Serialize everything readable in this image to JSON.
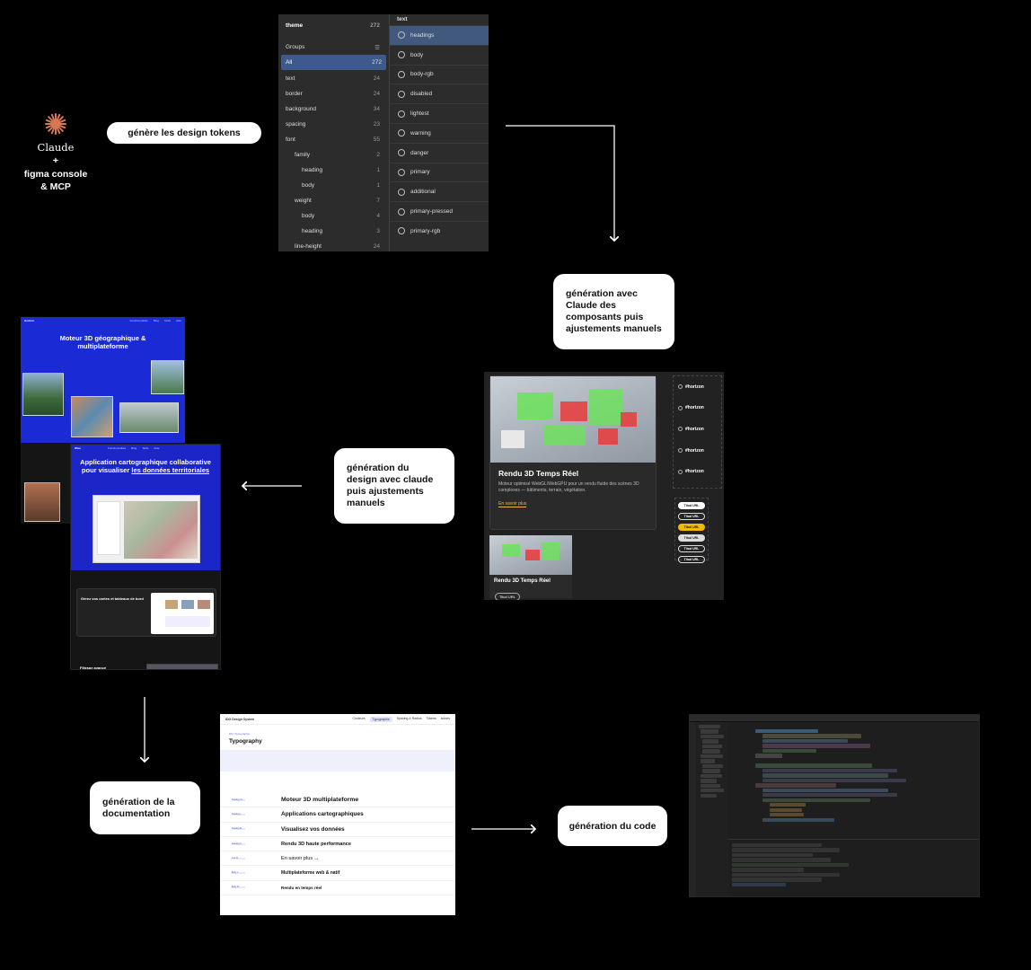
{
  "logo": {
    "wordmark": "Claude",
    "plus": "+",
    "line1": "figma console",
    "line2": "& MCP",
    "accent_color": "#d97757"
  },
  "steps": {
    "design_tokens": "génère les design tokens",
    "components": "génération avec Claude des composants puis ajustements manuels",
    "design": "génération du design avec claude puis ajustements manuels",
    "documentation": "génération de la documentation",
    "code": "génération du code"
  },
  "variables_panel": {
    "collection": "theme",
    "collection_count": "272",
    "groups_label": "Groups",
    "groups": [
      {
        "label": "All",
        "count": "272"
      },
      {
        "label": "text",
        "count": "24"
      },
      {
        "label": "border",
        "count": "24"
      },
      {
        "label": "background",
        "count": "34"
      },
      {
        "label": "spacing",
        "count": "23"
      },
      {
        "label": "font",
        "count": "55"
      },
      {
        "label": "family",
        "count": "2"
      },
      {
        "label": "heading",
        "count": "1"
      },
      {
        "label": "body",
        "count": "1"
      },
      {
        "label": "weight",
        "count": "7"
      },
      {
        "label": "body",
        "count": "4"
      },
      {
        "label": "heading",
        "count": "3"
      },
      {
        "label": "line-height",
        "count": "24"
      }
    ],
    "section_title": "text",
    "tokens": [
      "headings",
      "body",
      "body-rgb",
      "disabled",
      "lightest",
      "warning",
      "danger",
      "primary",
      "additional",
      "primary-pressed",
      "primary-rgb"
    ]
  },
  "components": {
    "card_title": "Rendu 3D Temps Réel",
    "card_desc": "Moteur optimisé WebGL/WebGPU pour un rendu fluide des scènes 3D complexes — bâtiments, terrain, végétation.",
    "card_link": "En savoir plus",
    "small_card_title": "Rendu 3D Temps Réel",
    "small_card_tag": "Titud URL",
    "variants": [
      "#horizon",
      "#horizon",
      "#horizon",
      "#horizon",
      "#horizon"
    ],
    "buttons": [
      "Titud URL",
      "Titud URL",
      "Titud URL",
      "Titud URL",
      "Titud URL",
      "Titud URL"
    ]
  },
  "site_a": {
    "title": "Moteur 3D géographique & multiplateforme",
    "brand": "Horizon",
    "nav": [
      "Fonctionnalités",
      "Blog",
      "Tarifs",
      "Aide"
    ]
  },
  "site_b": {
    "title_prefix": "Application cartographique collaborative pour visualiser",
    "title_highlight": "les données territoriales",
    "section_title": "Gérez vos cartes et tableaux de bord",
    "footer_title": "Filtrage avancé",
    "brand": "Wise",
    "nav": [
      "Fonctionnalités",
      "Blog",
      "Tarifs",
      "Aide"
    ]
  },
  "doc": {
    "brand": "IDG Design System",
    "tabs": [
      "Couleurs",
      "Typographie",
      "Spacing & Radius",
      "Tokens",
      "Icônes"
    ],
    "selected_tab": "Typographie",
    "crumb": "DS / Typographie",
    "title": "Typography",
    "rows": [
      {
        "tag": "Heading XL",
        "sample": "Moteur 3D multiplateforme"
      },
      {
        "tag": "Heading L",
        "sample": "Applications cartographiques"
      },
      {
        "tag": "Heading M",
        "sample": "Visualisez vos données"
      },
      {
        "tag": "Heading S",
        "sample": "Rendu 3D haute performance"
      },
      {
        "tag": "Link M",
        "sample": "En savoir plus →"
      },
      {
        "tag": "Body L",
        "sample": "Multiplateforme web & natif"
      },
      {
        "tag": "Body M",
        "sample": "Rendu en temps réel"
      }
    ]
  }
}
